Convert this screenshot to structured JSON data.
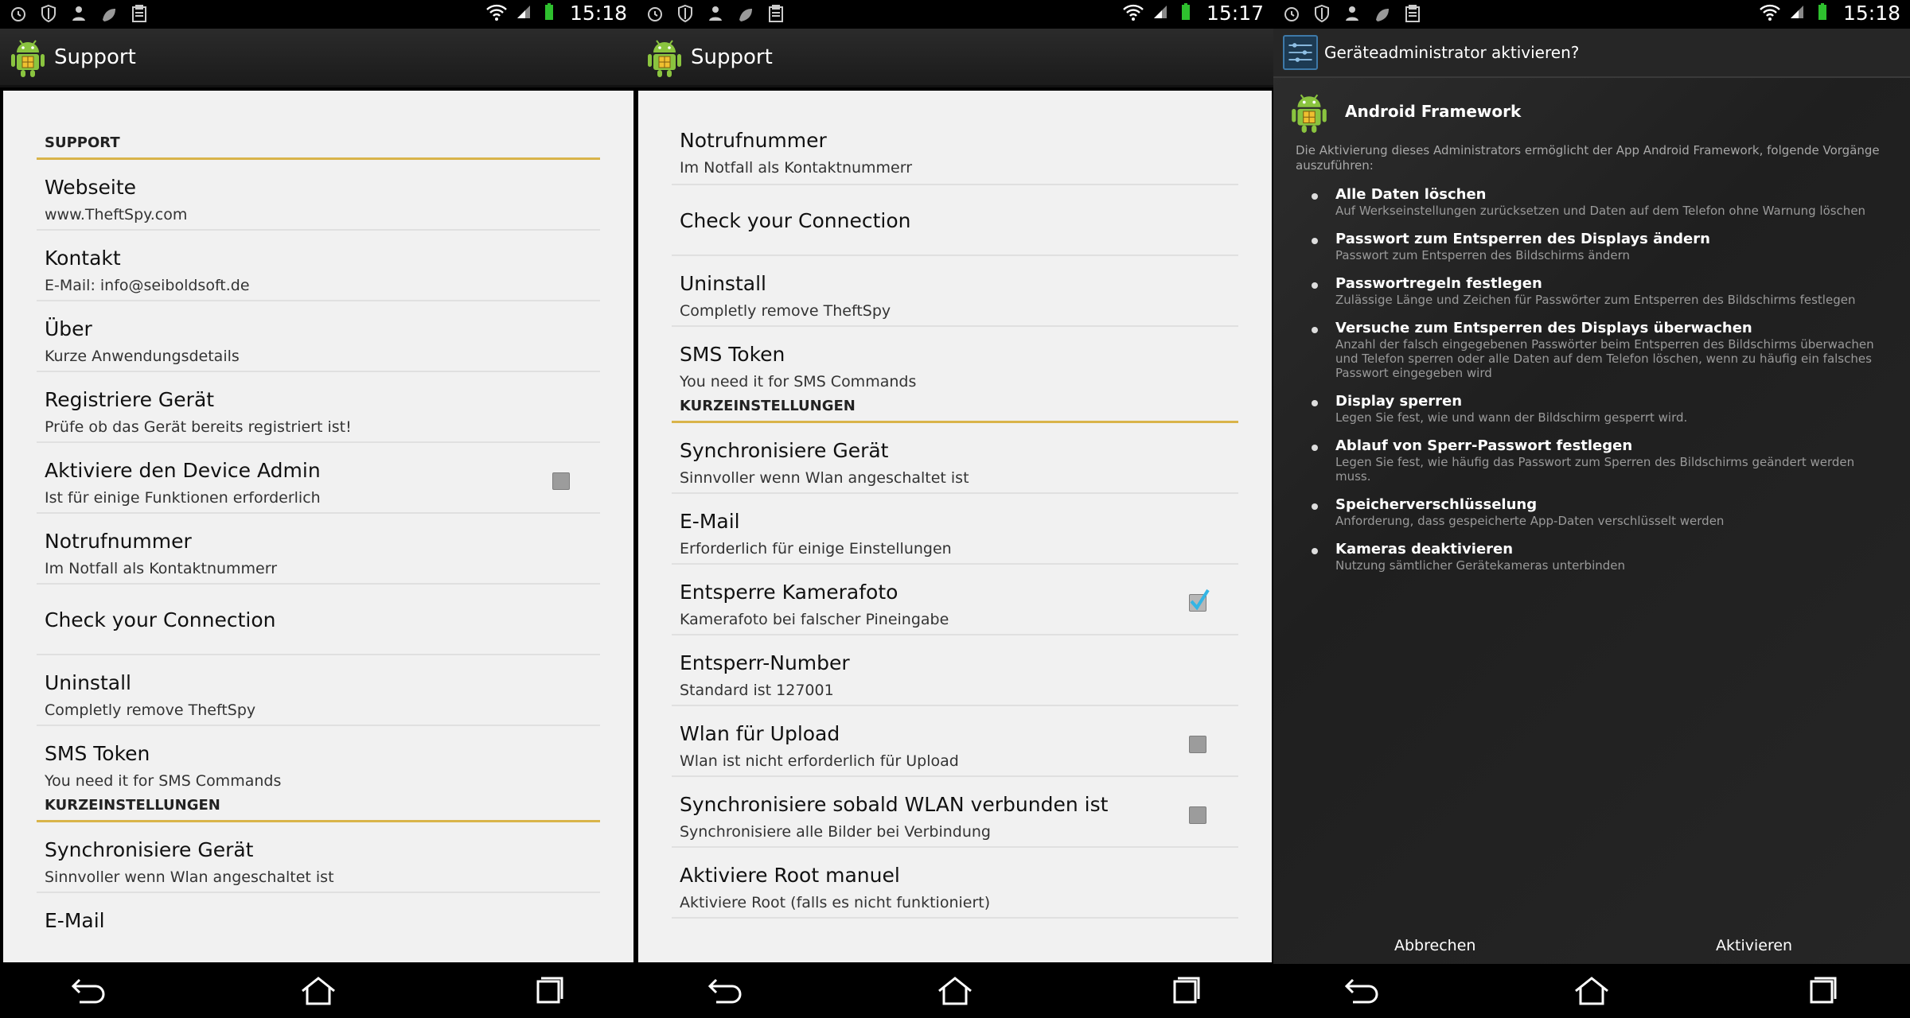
{
  "screens": [
    {
      "time": "15:18",
      "app_title": "Support",
      "categories": {
        "support": "SUPPORT",
        "quick": "KURZEINSTELLUNGEN"
      },
      "items": [
        {
          "title": "Webseite",
          "summary": "www.TheftSpy.com"
        },
        {
          "title": "Kontakt",
          "summary": "E-Mail: info@seiboldsoft.de"
        },
        {
          "title": "Über",
          "summary": "Kurze Anwendungsdetails"
        },
        {
          "title": "Registriere Gerät",
          "summary": "Prüfe ob das Gerät bereits registriert ist!"
        },
        {
          "title": "Aktiviere den Device Admin",
          "summary": "Ist für einige Funktionen erforderlich",
          "checked": false
        },
        {
          "title": "Notrufnummer",
          "summary": "Im Notfall als Kontaktnummerr"
        },
        {
          "title": "Check your Connection"
        },
        {
          "title": "Uninstall",
          "summary": "Completly remove TheftSpy"
        },
        {
          "title": "SMS Token",
          "summary": "You need it for SMS Commands"
        }
      ],
      "quick_items": [
        {
          "title": "Synchronisiere Gerät",
          "summary": "Sinnvoller wenn Wlan angeschaltet ist"
        },
        {
          "title": "E-Mail"
        }
      ]
    },
    {
      "time": "15:17",
      "app_title": "Support",
      "categories": {
        "quick": "KURZEINSTELLUNGEN"
      },
      "items": [
        {
          "title": "Notrufnummer",
          "summary": "Im Notfall als Kontaktnummerr"
        },
        {
          "title": "Check your Connection"
        },
        {
          "title": "Uninstall",
          "summary": "Completly remove TheftSpy"
        },
        {
          "title": "SMS Token",
          "summary": "You need it for SMS Commands"
        }
      ],
      "quick_items": [
        {
          "title": "Synchronisiere Gerät",
          "summary": "Sinnvoller wenn Wlan angeschaltet ist"
        },
        {
          "title": "E-Mail",
          "summary": "Erforderlich für einige Einstellungen"
        },
        {
          "title": "Entsperre Kamerafoto",
          "summary": "Kamerafoto bei falscher Pineingabe",
          "checked": true
        },
        {
          "title": "Entsperr-Number",
          "summary": "Standard ist 127001"
        },
        {
          "title": "Wlan für Upload",
          "summary": "Wlan ist nicht erforderlich für Upload",
          "checked": false
        },
        {
          "title": "Synchronisiere sobald WLAN verbunden ist",
          "summary": "Synchronisiere alle Bilder bei Verbindung",
          "checked": false
        },
        {
          "title": "Aktiviere Root manuel",
          "summary": "Aktiviere Root (falls es nicht funktioniert)"
        }
      ]
    },
    {
      "time": "15:18",
      "dialog_title": "Geräteadministrator aktivieren?",
      "app_name": "Android Framework",
      "description": "Die Aktivierung dieses Administrators ermöglicht der App Android Framework, folgende Vorgänge auszuführen:",
      "permissions": [
        {
          "title": "Alle Daten löschen",
          "desc": "Auf Werkseinstellungen zurücksetzen und Daten auf dem Telefon ohne Warnung löschen"
        },
        {
          "title": "Passwort zum Entsperren des Displays ändern",
          "desc": "Passwort zum Entsperren des Bildschirms ändern"
        },
        {
          "title": "Passwortregeln festlegen",
          "desc": "Zulässige Länge und Zeichen für Passwörter zum Entsperren des Bildschirms festlegen"
        },
        {
          "title": "Versuche zum Entsperren des Displays überwachen",
          "desc": "Anzahl der falsch eingegebenen Passwörter beim Entsperren des Bildschirms überwachen und Telefon sperren oder alle Daten auf dem Telefon löschen, wenn zu häufig ein falsches Passwort eingegeben wird"
        },
        {
          "title": "Display sperren",
          "desc": "Legen Sie fest, wie und wann der Bildschirm gesperrt wird."
        },
        {
          "title": "Ablauf von Sperr-Passwort festlegen",
          "desc": "Legen Sie fest, wie häufig das Passwort zum Sperren des Bildschirms geändert werden muss."
        },
        {
          "title": "Speicherverschlüsselung",
          "desc": "Anforderung, dass gespeicherte App-Daten verschlüsselt werden"
        },
        {
          "title": "Kameras deaktivieren",
          "desc": "Nutzung sämtlicher Gerätekameras unterbinden"
        }
      ],
      "cancel_label": "Abbrechen",
      "activate_label": "Aktivieren"
    }
  ],
  "colors": {
    "accent_divider": "#d9b44a",
    "list_bg": "#f1f1f1",
    "check_blue": "#33b5e5"
  }
}
